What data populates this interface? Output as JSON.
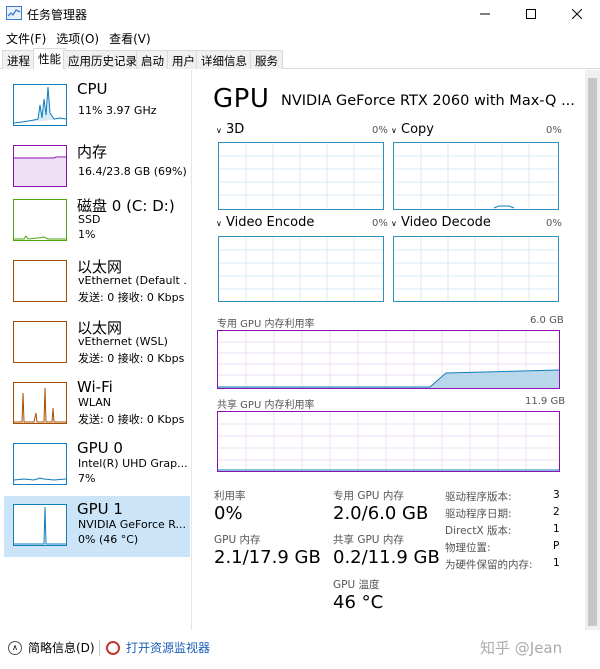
{
  "window": {
    "title": "任务管理器"
  },
  "menu": [
    {
      "label": "文件(F)"
    },
    {
      "label": "选项(O)"
    },
    {
      "label": "查看(V)"
    }
  ],
  "tabs": [
    {
      "label": "进程"
    },
    {
      "label": "性能"
    },
    {
      "label": "应用历史记录"
    },
    {
      "label": "启动"
    },
    {
      "label": "用户"
    },
    {
      "label": "详细信息"
    },
    {
      "label": "服务"
    }
  ],
  "sidebar": [
    {
      "title": "CPU",
      "line1": "11%  3.97 GHz",
      "line2": "",
      "color": "#117dbb"
    },
    {
      "title": "内存",
      "line1": "16.4/23.8 GB (69%)",
      "line2": "",
      "color": "#8b12ae"
    },
    {
      "title": "磁盘 0 (C: D:)",
      "line1": "SSD",
      "line2": "1%",
      "color": "#4da60c"
    },
    {
      "title": "以太网",
      "line1": "vEthernet (Default ...",
      "line2": "发送: 0 接收: 0 Kbps",
      "color": "#a74f01"
    },
    {
      "title": "以太网",
      "line1": "vEthernet (WSL)",
      "line2": "发送: 0 接收: 0 Kbps",
      "color": "#a74f01"
    },
    {
      "title": "Wi-Fi",
      "line1": "WLAN",
      "line2": "发送: 0 接收: 0 Kbps",
      "color": "#a74f01"
    },
    {
      "title": "GPU 0",
      "line1": "Intel(R) UHD Grap...",
      "line2": "7%",
      "color": "#117dbb"
    },
    {
      "title": "GPU 1",
      "line1": "NVIDIA GeForce R...",
      "line2": "0% (46 °C)",
      "color": "#117dbb"
    }
  ],
  "main": {
    "heading": "GPU",
    "model": "NVIDIA GeForce RTX 2060 with Max-Q ...",
    "engines": [
      {
        "label": "3D",
        "pct": "0%"
      },
      {
        "label": "Copy",
        "pct": "0%"
      },
      {
        "label": "Video Encode",
        "pct": "0%"
      },
      {
        "label": "Video Decode",
        "pct": "0%"
      }
    ],
    "dedicated": {
      "label": "专用 GPU 内存利用率",
      "max": "6.0 GB"
    },
    "shared": {
      "label": "共享 GPU 内存利用率",
      "max": "11.9 GB"
    },
    "stats": {
      "util_label": "利用率",
      "util_value": "0%",
      "ded_label": "专用 GPU 内存",
      "ded_value": "2.0/6.0 GB",
      "gpumem_label": "GPU 内存",
      "gpumem_value": "2.1/17.9 GB",
      "shr_label": "共享 GPU 内存",
      "shr_value": "0.2/11.9 GB",
      "temp_label": "GPU 温度",
      "temp_value": "46 °C"
    },
    "info": [
      {
        "label": "驱动程序版本:",
        "value": "3"
      },
      {
        "label": "驱动程序日期:",
        "value": "2"
      },
      {
        "label": "DirectX 版本:",
        "value": "1"
      },
      {
        "label": "物理位置:",
        "value": "P"
      },
      {
        "label": "为硬件保留的内存:",
        "value": "1"
      }
    ]
  },
  "footer": {
    "summary": "简略信息(D)",
    "monitor": "打开资源监视器",
    "watermark": "知乎 @Jean"
  }
}
